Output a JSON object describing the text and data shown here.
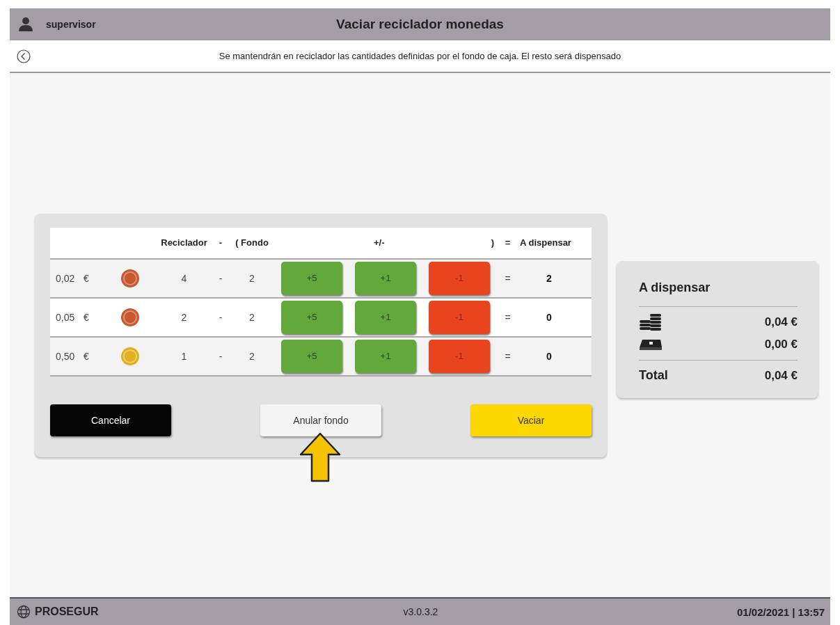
{
  "header": {
    "user": "supervisor",
    "title": "Vaciar reciclador monedas"
  },
  "subheader": {
    "message": "Se mantendrán en reciclador las cantidades definidas por el fondo de caja. El resto será dispensado"
  },
  "table": {
    "columns": [
      "Reciclador",
      "-",
      "( Fondo",
      "+/-",
      ")",
      "=",
      "A dispensar"
    ],
    "rows": [
      {
        "denomination": "0,02",
        "currency": "€",
        "color": "#c8582e",
        "recycler": "4",
        "minus": "-",
        "fund": "2",
        "buttons": [
          {
            "label": "+5",
            "kind": "add"
          },
          {
            "label": "+1",
            "kind": "add"
          },
          {
            "label": "-1",
            "kind": "subtract"
          }
        ],
        "equals": "=",
        "result": "2"
      },
      {
        "denomination": "0,05",
        "currency": "€",
        "color": "#c8582e",
        "recycler": "2",
        "minus": "-",
        "fund": "2",
        "buttons": [
          {
            "label": "+5",
            "kind": "add"
          },
          {
            "label": "+1",
            "kind": "add"
          },
          {
            "label": "-1",
            "kind": "subtract"
          }
        ],
        "equals": "=",
        "result": "0"
      },
      {
        "denomination": "0,50",
        "currency": "€",
        "color": "#e0b020",
        "recycler": "1",
        "minus": "-",
        "fund": "2",
        "buttons": [
          {
            "label": "+5",
            "kind": "add"
          },
          {
            "label": "+1",
            "kind": "add"
          },
          {
            "label": "-1",
            "kind": "subtract"
          }
        ],
        "equals": "=",
        "result": "0"
      }
    ]
  },
  "actions": [
    {
      "label": "Cancelar",
      "kind": "dark"
    },
    {
      "label": "Anular fondo",
      "kind": "light"
    },
    {
      "label": "Vaciar",
      "kind": "primary"
    }
  ],
  "summary": {
    "title": "A dispensar",
    "lines": [
      {
        "kind": "coins",
        "amount": "0,04 €"
      },
      {
        "kind": "notes",
        "amount": "0,00 €"
      }
    ],
    "total_label": "Total",
    "total": "0,04 €"
  },
  "footer": {
    "brand": "PROSEGUR",
    "version": "v3.0.3.2",
    "datetime": "01/02/2021 | 13:57"
  }
}
